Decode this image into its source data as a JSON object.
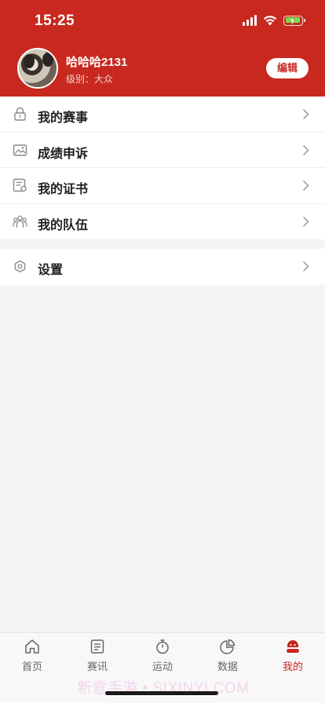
{
  "status_bar": {
    "time": "15:25"
  },
  "profile": {
    "name": "哈哈哈2131",
    "level": "级别：大众",
    "edit_label": "编辑"
  },
  "menu_main": [
    {
      "label": "我的赛事",
      "icon": "lock-icon"
    },
    {
      "label": "成绩申诉",
      "icon": "image-icon"
    },
    {
      "label": "我的证书",
      "icon": "certificate-icon"
    },
    {
      "label": "我的队伍",
      "icon": "team-icon"
    }
  ],
  "menu_settings": [
    {
      "label": "设置",
      "icon": "gear-icon"
    }
  ],
  "tabbar": [
    {
      "label": "首页",
      "icon": "home-icon"
    },
    {
      "label": "赛讯",
      "icon": "news-icon"
    },
    {
      "label": "运动",
      "icon": "stopwatch-icon"
    },
    {
      "label": "数据",
      "icon": "pie-chart-icon"
    },
    {
      "label": "我的",
      "icon": "profile-icon",
      "active": true
    }
  ],
  "watermark": "新意手游 • SIXINYI.COM",
  "colors": {
    "brand": "#c8281e",
    "background": "#f4f4f4"
  }
}
